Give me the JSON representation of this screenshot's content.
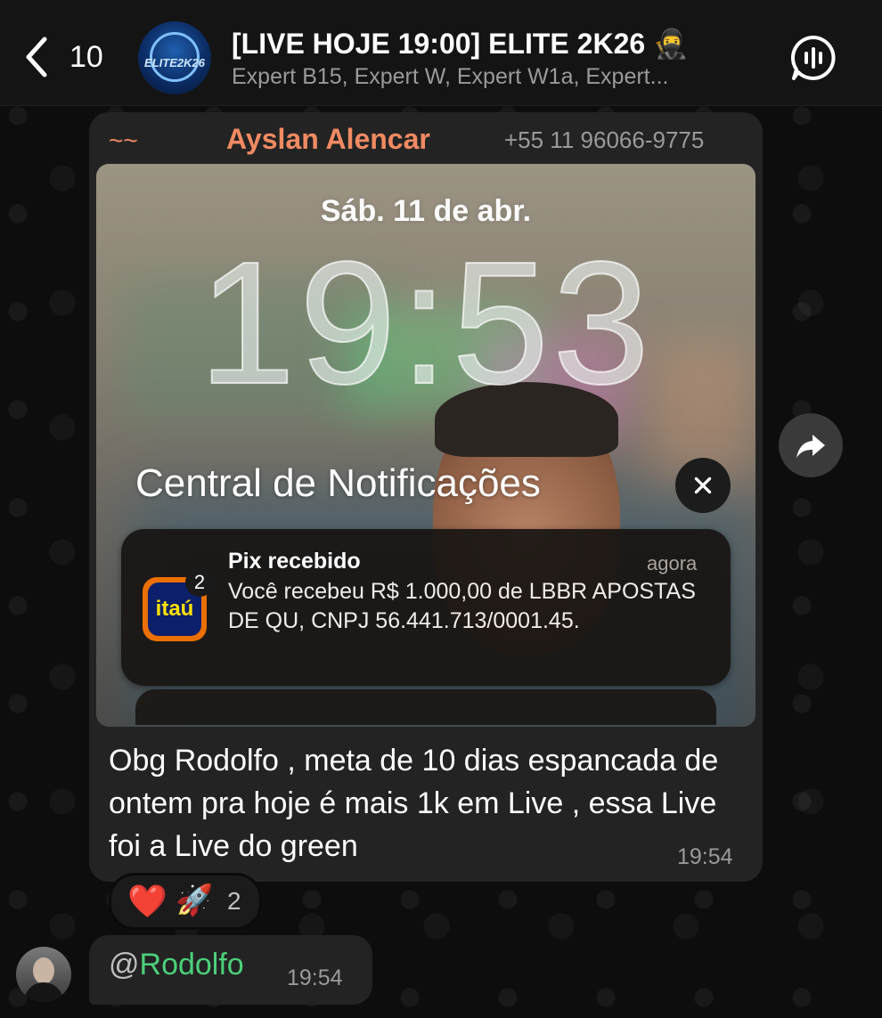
{
  "header": {
    "back_count": "10",
    "avatar_text": "ELITE2K26",
    "title": "[LIVE HOJE 19:00] ELITE 2K26 🥷",
    "subtitle": "Expert B15, Expert W, Expert W1a, Expert..."
  },
  "message": {
    "tilde": "~~",
    "sender": "Ayslan Alencar",
    "phone": "+55 11 96066-9775",
    "photo": {
      "date": "Sáb. 11 de abr.",
      "time": "19:53",
      "center_title": "Central de Notificações",
      "notification": {
        "app_icon_text": "itaú",
        "badge": "2",
        "title": "Pix recebido",
        "time": "agora",
        "body": "Você recebeu R$ 1.000,00 de LBBR APOSTAS DE QU, CNPJ 56.441.713/0001.45."
      }
    },
    "caption": "Obg Rodolfo , meta de 10 dias espancada de ontem pra hoje é mais 1k em Live , essa Live foi a Live do green",
    "time": "19:54",
    "reactions": {
      "heart": "❤️",
      "rocket": "🚀",
      "count": "2"
    }
  },
  "reply": {
    "at": "@",
    "mention": "Rodolfo",
    "time": "19:54"
  },
  "icons": {
    "back": "chevron-left-icon",
    "voice": "voice-chat-icon",
    "close": "close-icon",
    "forward": "forward-icon"
  },
  "colors": {
    "sender": "#f08a62",
    "mention": "#4cd07a",
    "bubble": "#232323",
    "itau_orange": "#ec7000",
    "itau_blue": "#0b1f6a"
  }
}
